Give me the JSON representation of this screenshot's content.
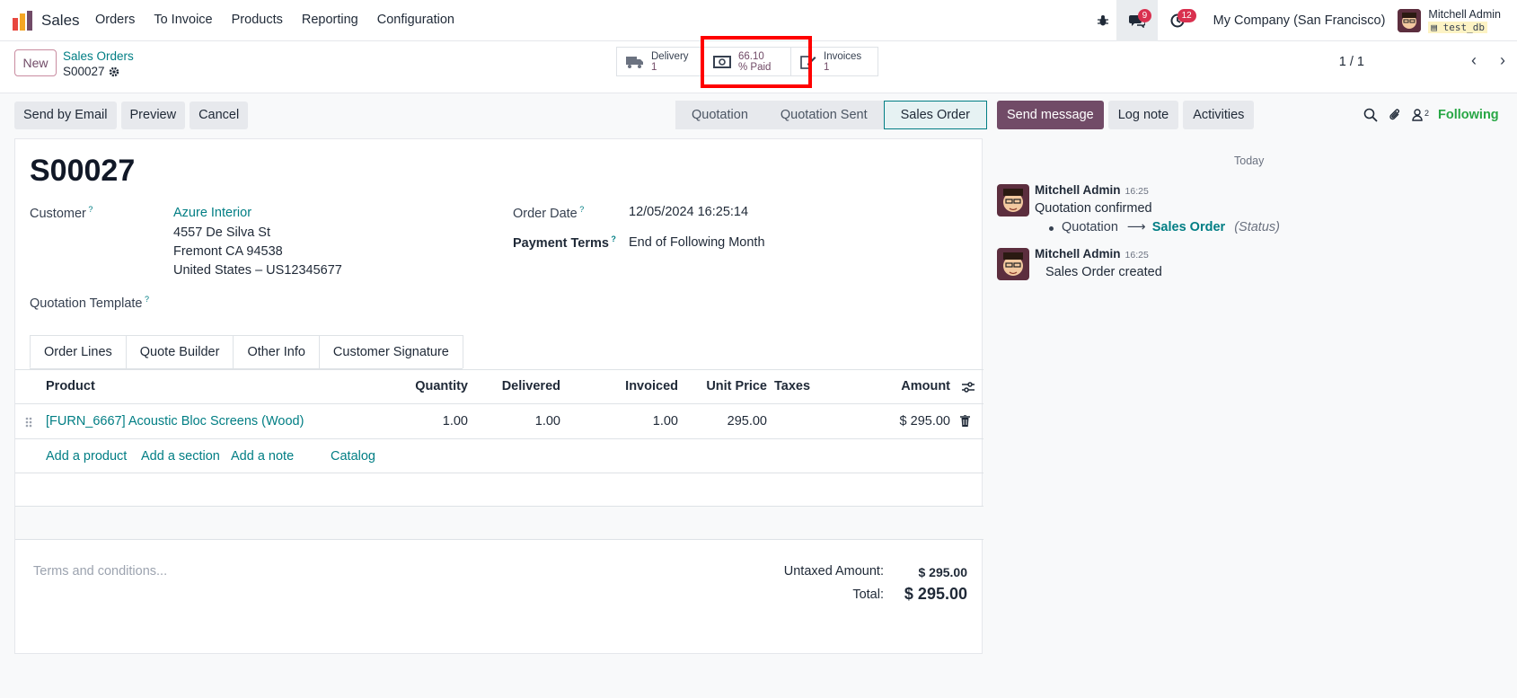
{
  "navbar": {
    "app_name": "Sales",
    "menu": [
      "Orders",
      "To Invoice",
      "Products",
      "Reporting",
      "Configuration"
    ],
    "messages_count": "9",
    "activities_count": "12",
    "company": "My Company (San Francisco)",
    "user_name": "Mitchell Admin",
    "db_name": "test_db"
  },
  "control_panel": {
    "new_label": "New",
    "breadcrumb_parent": "Sales Orders",
    "breadcrumb_current": "S00027",
    "smart_buttons": {
      "delivery_label": "Delivery",
      "delivery_value": "1",
      "paid_value": "66.10",
      "paid_label": "% Paid",
      "invoices_label": "Invoices",
      "invoices_value": "1"
    },
    "pager": "1 / 1"
  },
  "actions": [
    "Send by Email",
    "Preview",
    "Cancel"
  ],
  "statusbar": [
    "Quotation",
    "Quotation Sent",
    "Sales Order"
  ],
  "form": {
    "order_name": "S00027",
    "customer_label": "Customer",
    "customer_name": "Azure Interior",
    "address_line1": "4557 De Silva St",
    "address_line2": "Fremont CA 94538",
    "address_line3": "United States – US12345677",
    "order_date_label": "Order Date",
    "order_date_value": "12/05/2024 16:25:14",
    "payment_terms_label": "Payment Terms",
    "payment_terms_value": "End of Following Month",
    "quotation_template_label": "Quotation Template",
    "tabs": [
      "Order Lines",
      "Quote Builder",
      "Other Info",
      "Customer Signature"
    ],
    "columns": [
      "Product",
      "Quantity",
      "Delivered",
      "Invoiced",
      "Unit Price",
      "Taxes",
      "Amount"
    ],
    "line": {
      "product": "[FURN_6667] Acoustic Bloc Screens (Wood)",
      "quantity": "1.00",
      "delivered": "1.00",
      "invoiced": "1.00",
      "unit_price": "295.00",
      "taxes": "",
      "amount": "$ 295.00"
    },
    "add_links": [
      "Add a product",
      "Add a section",
      "Add a note",
      "Catalog"
    ],
    "terms_placeholder": "Terms and conditions...",
    "untaxed_label": "Untaxed Amount:",
    "untaxed_value": "$ 295.00",
    "total_label": "Total:",
    "total_value": "$ 295.00"
  },
  "chatter": {
    "buttons": [
      "Send message",
      "Log note",
      "Activities"
    ],
    "followers_count": "2",
    "following_label": "Following",
    "today_label": "Today",
    "messages": [
      {
        "author": "Mitchell Admin",
        "time": "16:25",
        "body": "Quotation confirmed",
        "change_from": "Quotation",
        "change_arrow": "⟶",
        "change_to": "Sales Order",
        "change_field": "(Status)"
      },
      {
        "author": "Mitchell Admin",
        "time": "16:25",
        "body": "Sales Order created"
      }
    ]
  },
  "colors": {
    "brand": "#714b67",
    "link": "#017e84",
    "highlight": "#ff0000",
    "following": "#28a745"
  }
}
